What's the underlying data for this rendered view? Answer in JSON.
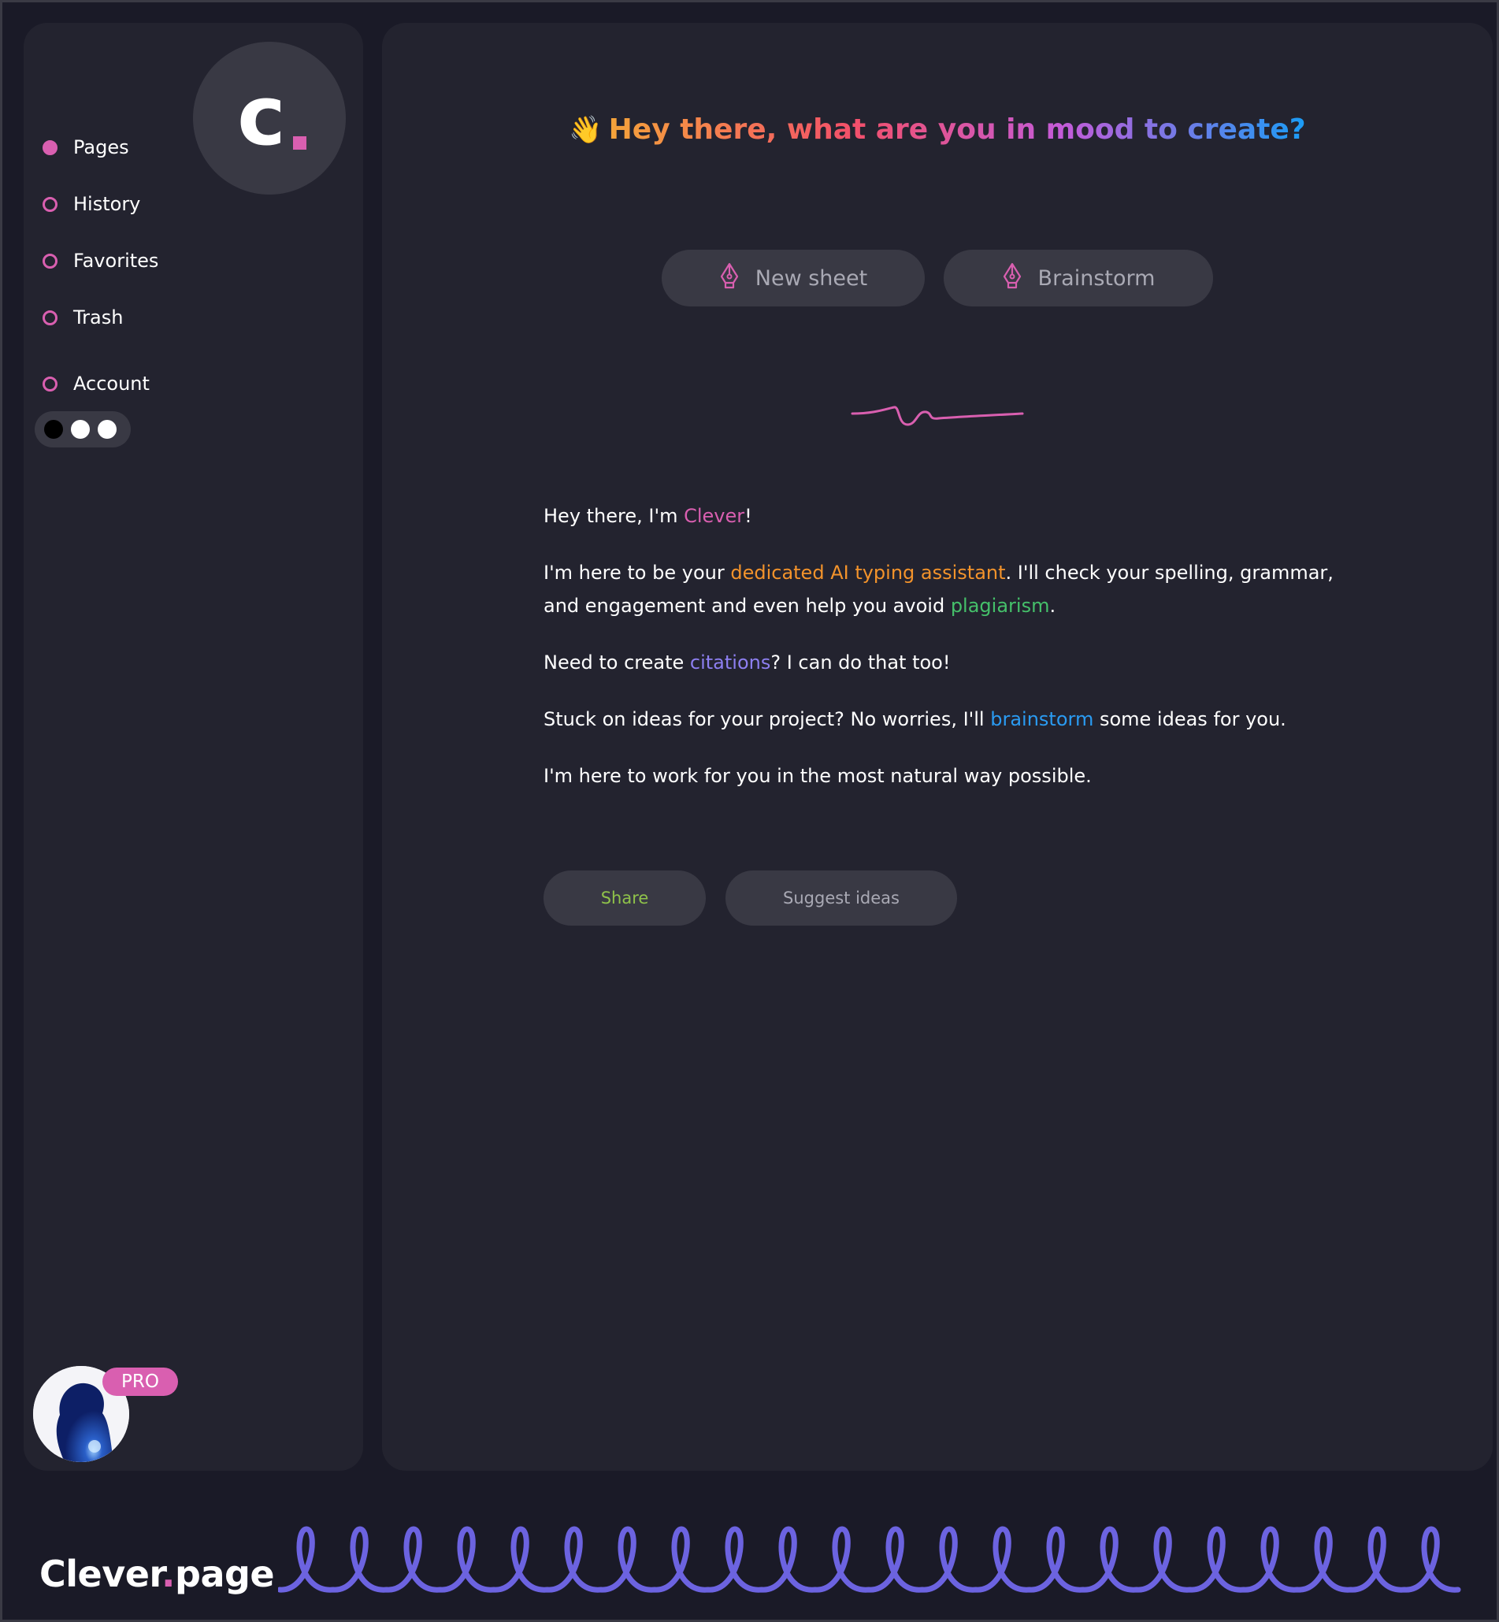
{
  "sidebar": {
    "logo_letter": "c",
    "nav": [
      {
        "label": "Pages",
        "active": true
      },
      {
        "label": "History",
        "active": false
      },
      {
        "label": "Favorites",
        "active": false
      },
      {
        "label": "Trash",
        "active": false
      },
      {
        "label": "Account",
        "active": false
      }
    ],
    "theme_toggle": {
      "options": [
        "dark",
        "light",
        "light"
      ],
      "colors": [
        "#000000",
        "#ffffff",
        "#ffffff"
      ]
    },
    "profile": {
      "badge": "PRO"
    }
  },
  "main": {
    "heading_emoji": "👋",
    "heading": "Hey there, what are you in mood to create?",
    "quick_actions": [
      {
        "label": "New sheet",
        "icon": "pen-nib-icon"
      },
      {
        "label": "Brainstorm",
        "icon": "pen-nib-icon"
      }
    ],
    "message": {
      "p1": {
        "pre": "Hey there, I'm ",
        "hl": "Clever",
        "post": "!"
      },
      "p2": {
        "pre": "I'm here to be your ",
        "hl1": "dedicated AI typing assistant",
        "mid": ". I'll check your spelling, grammar, and engagement and even help you avoid ",
        "hl2": "plagiarism",
        "post": "."
      },
      "p3": {
        "pre": "Need to create ",
        "hl": "citations",
        "post": "? I can do that too!"
      },
      "p4": {
        "pre": "Stuck on ideas for your project? No worries, I'll ",
        "hl": "brainstorm",
        "post": " some ideas for you."
      },
      "p5": {
        "text": "I'm here to work for you in the most natural way possible."
      }
    },
    "actions": {
      "share": "Share",
      "suggest": "Suggest ideas"
    }
  },
  "brand": {
    "name": "Clever",
    "dot": ".",
    "suffix": "page"
  },
  "colors": {
    "accent": "#d95fb0",
    "orange": "#f3932b",
    "green": "#45c06a",
    "purple": "#8d7ff0",
    "blue": "#2a9bf2",
    "share": "#8fc24a",
    "squiggle": "#6c63e0"
  }
}
